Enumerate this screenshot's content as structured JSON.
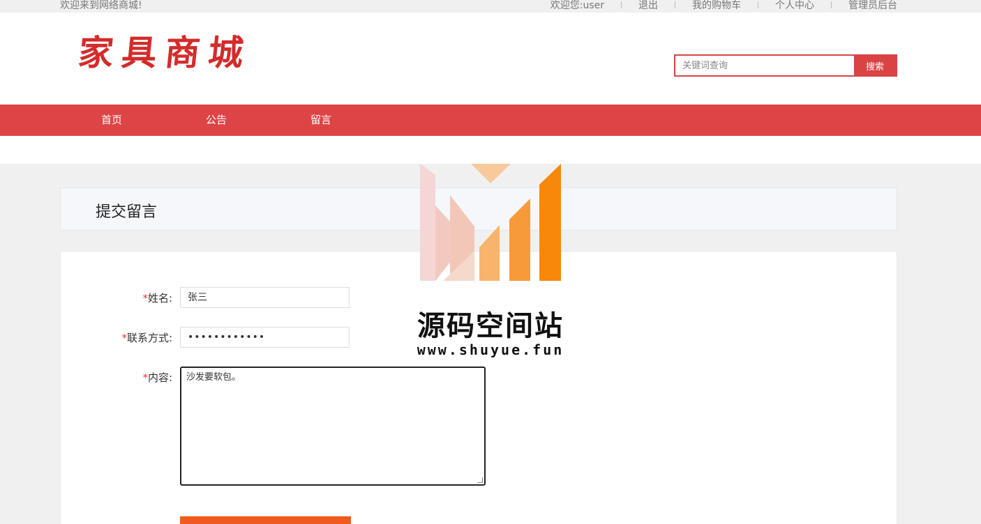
{
  "topbar": {
    "welcome": "欢迎来到网络商城!",
    "user_greeting": "欢迎您:user",
    "logout": "退出",
    "cart": "我的购物车",
    "profile": "个人中心",
    "admin": "管理员后台"
  },
  "header": {
    "logo_text": "家具商城",
    "search_placeholder": "关键词查询",
    "search_button": "搜索"
  },
  "nav": {
    "items": [
      {
        "label": "首页"
      },
      {
        "label": "公告"
      },
      {
        "label": "留言"
      }
    ]
  },
  "main": {
    "title": "提交留言",
    "form": {
      "name_label": "姓名:",
      "name_value": "张三",
      "contact_label": "联系方式:",
      "contact_value": "••••••••••••",
      "content_label": "内容:",
      "content_value": "沙发要软包。",
      "required_mark": "*",
      "submit_label": ""
    }
  },
  "watermark": {
    "title": "源码空间站",
    "url": "www.shuyue.fun"
  },
  "colors": {
    "brand_red": "#dd4446",
    "submit_orange": "#f05a1e",
    "required_star": "#e53935"
  }
}
